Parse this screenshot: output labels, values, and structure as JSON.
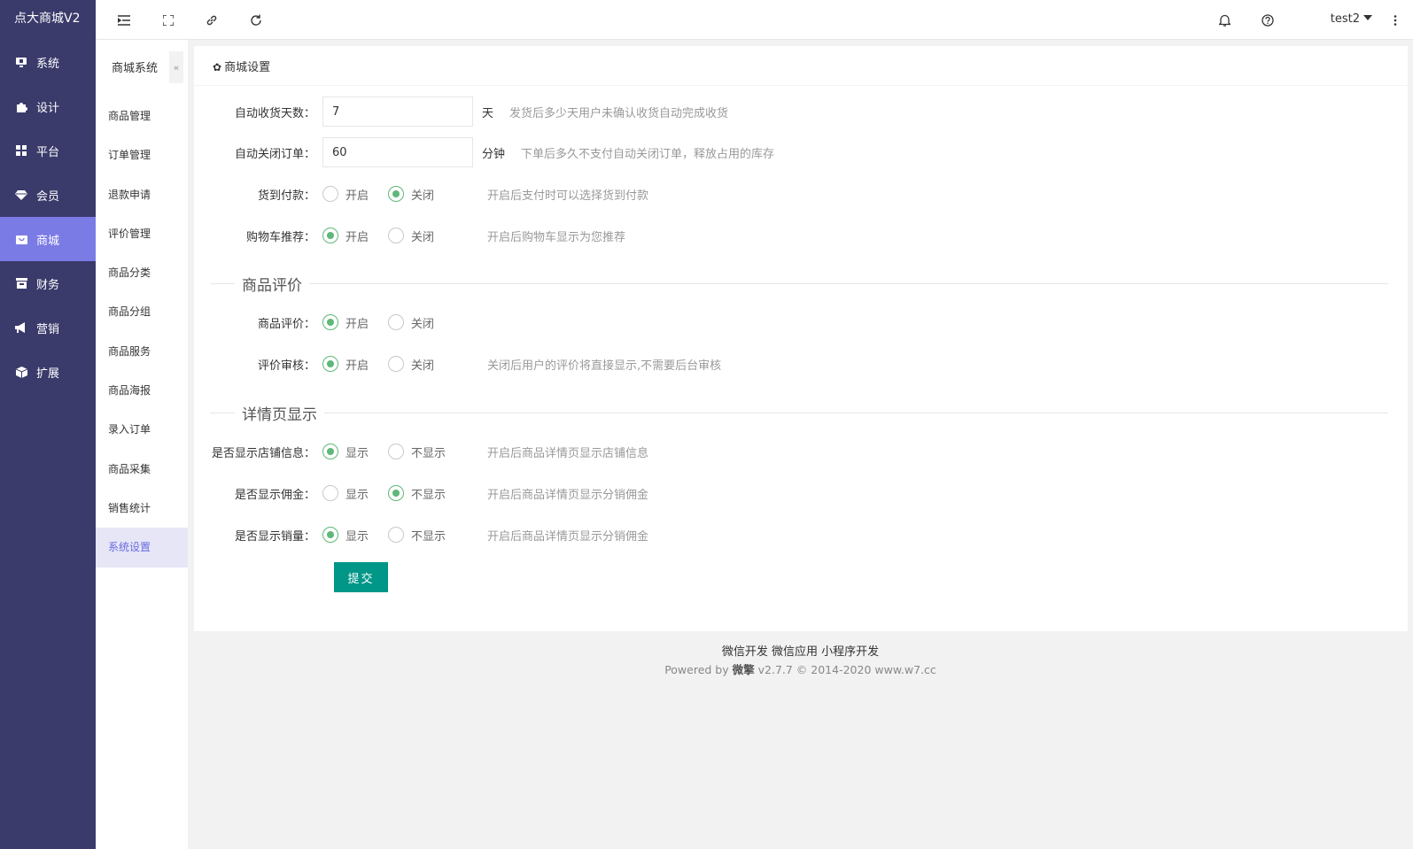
{
  "app": {
    "title": "点大商城V2"
  },
  "sidebar": {
    "items": [
      {
        "label": "系统",
        "icon": "monitor-icon"
      },
      {
        "label": "设计",
        "icon": "puzzle-icon"
      },
      {
        "label": "平台",
        "icon": "grid-icon"
      },
      {
        "label": "会员",
        "icon": "diamond-icon"
      },
      {
        "label": "商城",
        "icon": "shop-icon",
        "active": true
      },
      {
        "label": "财务",
        "icon": "wallet-icon"
      },
      {
        "label": "营销",
        "icon": "megaphone-icon"
      },
      {
        "label": "扩展",
        "icon": "cube-icon"
      }
    ]
  },
  "header": {
    "user": "test2"
  },
  "subnav": {
    "title": "商城系统",
    "collapse": "«",
    "items": [
      "商品管理",
      "订单管理",
      "退款申请",
      "评价管理",
      "商品分类",
      "商品分组",
      "商品服务",
      "商品海报",
      "录入订单",
      "商品采集",
      "销售统计",
      "系统设置"
    ],
    "active_index": 11
  },
  "card": {
    "title": "商城设置"
  },
  "form": {
    "auto_receive": {
      "label": "自动收货天数：",
      "value": "7",
      "unit": "天",
      "tip": "发货后多少天用户未确认收货自动完成收货"
    },
    "auto_close": {
      "label": "自动关闭订单：",
      "value": "60",
      "unit": "分钟",
      "tip": "下单后多久不支付自动关闭订单，释放占用的库存"
    },
    "cod": {
      "label": "货到付款：",
      "opt1": "开启",
      "opt2": "关闭",
      "selected": 2,
      "tip": "开启后支付时可以选择货到付款"
    },
    "cart_recommend": {
      "label": "购物车推荐：",
      "opt1": "开启",
      "opt2": "关闭",
      "selected": 1,
      "tip": "开启后购物车显示为您推荐"
    },
    "section_review": "商品评价",
    "review": {
      "label": "商品评价：",
      "opt1": "开启",
      "opt2": "关闭",
      "selected": 1,
      "tip": ""
    },
    "review_audit": {
      "label": "评价审核：",
      "opt1": "开启",
      "opt2": "关闭",
      "selected": 1,
      "tip": "关闭后用户的评价将直接显示,不需要后台审核"
    },
    "section_detail": "详情页显示",
    "show_shop": {
      "label": "是否显示店铺信息：",
      "opt1": "显示",
      "opt2": "不显示",
      "selected": 1,
      "tip": "开启后商品详情页显示店铺信息"
    },
    "show_commission": {
      "label": "是否显示佣金：",
      "opt1": "显示",
      "opt2": "不显示",
      "selected": 2,
      "tip": "开启后商品详情页显示分销佣金"
    },
    "show_sales": {
      "label": "是否显示销量：",
      "opt1": "显示",
      "opt2": "不显示",
      "selected": 1,
      "tip": "开启后商品详情页显示分销佣金"
    },
    "submit": "提交"
  },
  "footer": {
    "links": "微信开发 微信应用 小程序开发",
    "powered": "Powered by",
    "brand": "微擎",
    "version": "v2.7.7 © 2014-2020",
    "site": "www.w7.cc"
  },
  "colors": {
    "sidebar": "#3a3a6b",
    "active": "#7b7be6",
    "radio": "#5fb878",
    "submit": "#009688"
  }
}
